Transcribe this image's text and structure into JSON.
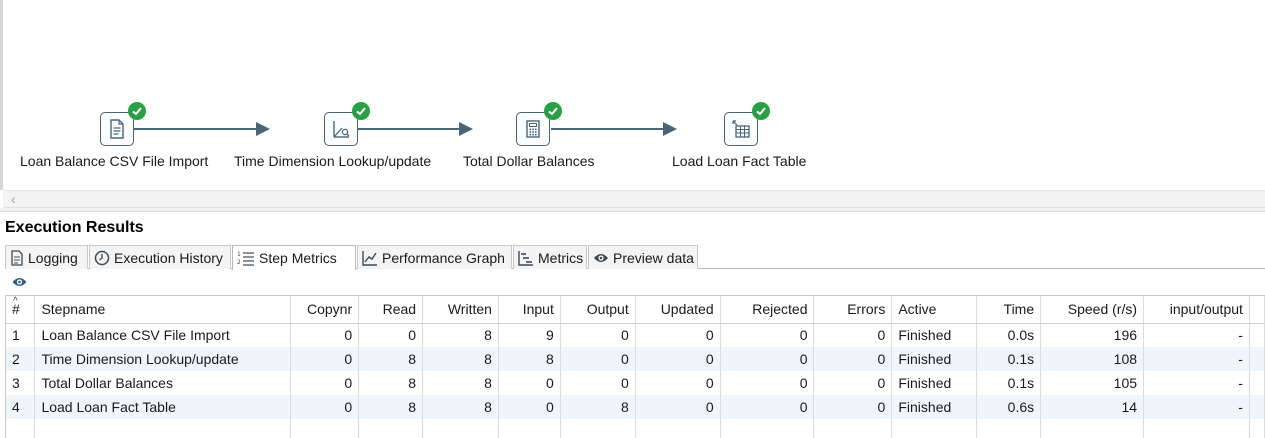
{
  "canvas": {
    "steps": [
      {
        "label": "Loan Balance CSV File Import",
        "icon": "csv-file-input-icon"
      },
      {
        "label": "Time Dimension Lookup/update",
        "icon": "dimension-lookup-icon"
      },
      {
        "label": "Total Dollar Balances",
        "icon": "calculator-icon"
      },
      {
        "label": "Load Loan Fact Table",
        "icon": "table-output-icon"
      }
    ],
    "status_icon": "success-check-icon",
    "hop_color": "#4b6477",
    "check_color": "#2aa046"
  },
  "results": {
    "title": "Execution Results",
    "tabs": [
      {
        "label": "Logging",
        "icon": "document-icon"
      },
      {
        "label": "Execution History",
        "icon": "clock-icon"
      },
      {
        "label": "Step Metrics",
        "icon": "numbered-list-icon",
        "active": true
      },
      {
        "label": "Performance Graph",
        "icon": "line-chart-icon"
      },
      {
        "label": "Metrics",
        "icon": "gantt-icon"
      },
      {
        "label": "Preview data",
        "icon": "eye-icon"
      }
    ],
    "toolbar_icon": "eye-icon",
    "columns": [
      "#",
      "Stepname",
      "Copynr",
      "Read",
      "Written",
      "Input",
      "Output",
      "Updated",
      "Rejected",
      "Errors",
      "Active",
      "Time",
      "Speed (r/s)",
      "input/output"
    ],
    "rows": [
      [
        "1",
        "Loan Balance CSV File Import",
        "0",
        "0",
        "8",
        "9",
        "0",
        "0",
        "0",
        "0",
        "Finished",
        "0.0s",
        "196",
        "-"
      ],
      [
        "2",
        "Time Dimension Lookup/update",
        "0",
        "8",
        "8",
        "8",
        "0",
        "0",
        "0",
        "0",
        "Finished",
        "0.1s",
        "108",
        "-"
      ],
      [
        "3",
        "Total Dollar Balances",
        "0",
        "8",
        "8",
        "0",
        "0",
        "0",
        "0",
        "0",
        "Finished",
        "0.1s",
        "105",
        "-"
      ],
      [
        "4",
        "Load Loan Fact Table",
        "0",
        "8",
        "8",
        "0",
        "8",
        "0",
        "0",
        "0",
        "Finished",
        "0.6s",
        "14",
        "-"
      ]
    ],
    "alt_row_color": "#eef5fb"
  }
}
